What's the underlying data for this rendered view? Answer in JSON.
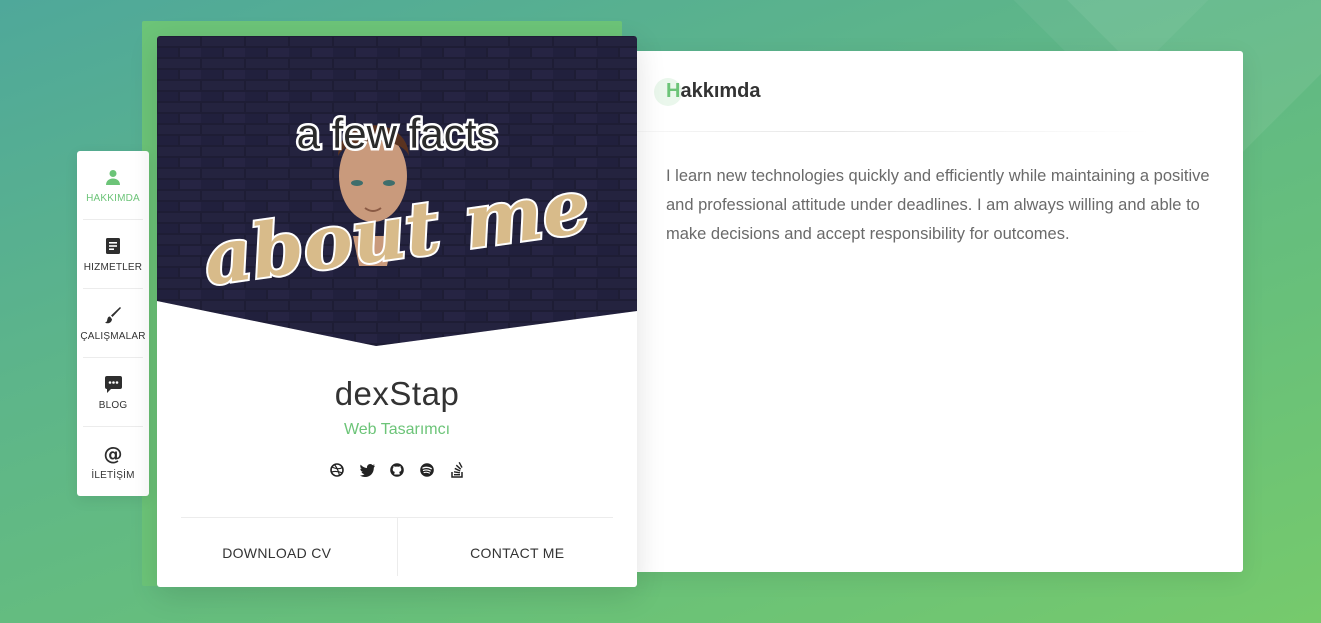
{
  "nav": {
    "items": [
      {
        "label": "HAKKIMDA",
        "icon": "user-icon",
        "active": true
      },
      {
        "label": "HIZMETLER",
        "icon": "document-icon"
      },
      {
        "label": "ÇALIŞMALAR",
        "icon": "brush-icon"
      },
      {
        "label": "BLOG",
        "icon": "chat-icon"
      },
      {
        "label": "İLETİŞİM",
        "icon": "at-icon"
      }
    ]
  },
  "profile": {
    "cover_line1": "a few facts",
    "cover_line2": "about me",
    "name": "dexStap",
    "role": "Web Tasarımcı",
    "socials": [
      "dribbble-icon",
      "twitter-icon",
      "github-icon",
      "spotify-icon",
      "stackoverflow-icon"
    ],
    "download_cv": "DOWNLOAD CV",
    "contact_me": "CONTACT ME"
  },
  "section": {
    "title_first": "H",
    "title_rest": "akkımda",
    "text": "I learn new technologies quickly and efficiently while maintaining a positive and professional attitude under deadlines. I am always willing and able to make decisions and accept responsibility for outcomes."
  },
  "colors": {
    "accent": "#6cc478",
    "text_dark": "#333333",
    "text_muted": "#6a6a6a",
    "cover_bg": "#25233f"
  }
}
